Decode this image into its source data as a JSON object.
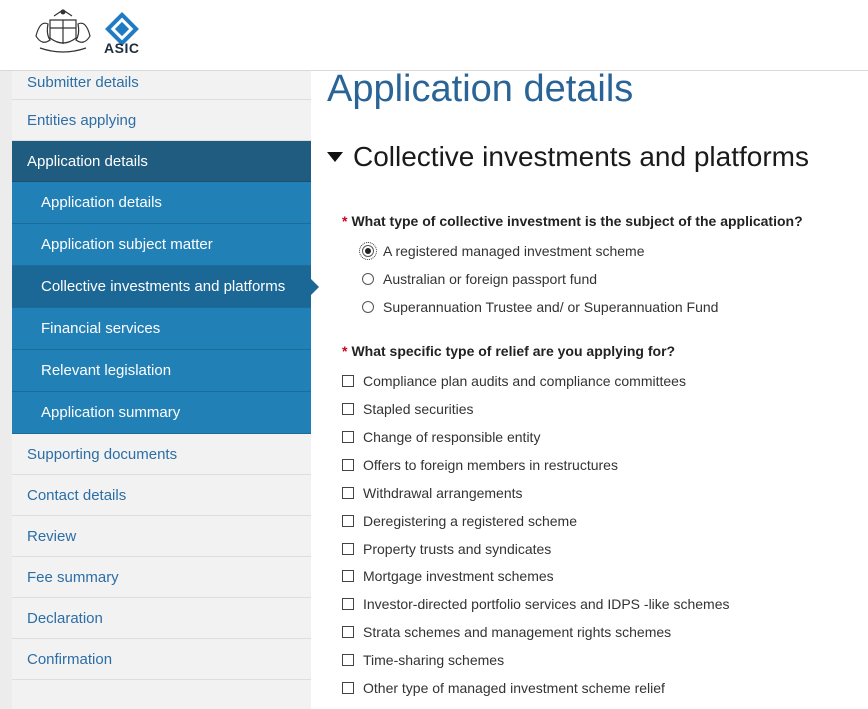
{
  "brand": {
    "logo_text": "ASIC"
  },
  "sidebar": {
    "items_top": [
      {
        "label": "Submitter details"
      },
      {
        "label": "Entities applying"
      }
    ],
    "active_section": {
      "label": "Application details"
    },
    "sub_items": [
      {
        "label": "Application details"
      },
      {
        "label": "Application subject matter"
      },
      {
        "label": "Collective investments and platforms",
        "current": true
      },
      {
        "label": "Financial services"
      },
      {
        "label": "Relevant legislation"
      },
      {
        "label": "Application summary"
      }
    ],
    "items_bottom": [
      {
        "label": "Supporting documents"
      },
      {
        "label": "Contact details"
      },
      {
        "label": "Review"
      },
      {
        "label": "Fee summary"
      },
      {
        "label": "Declaration"
      },
      {
        "label": "Confirmation"
      }
    ]
  },
  "main": {
    "page_title": "Application details",
    "section_title": "Collective investments and platforms",
    "q1": {
      "required_mark": "*",
      "label": "What type of collective investment is the subject of the application?",
      "options": [
        {
          "label": "A registered managed investment scheme",
          "selected": true
        },
        {
          "label": "Australian or foreign passport fund",
          "selected": false
        },
        {
          "label": "Superannuation Trustee and/ or Superannuation Fund",
          "selected": false
        }
      ]
    },
    "q2": {
      "required_mark": "*",
      "label": "What specific type of relief are you applying for?",
      "options": [
        {
          "label": "Compliance plan audits and compliance committees",
          "checked": false
        },
        {
          "label": "Stapled securities",
          "checked": false
        },
        {
          "label": "Change of responsible entity",
          "checked": false
        },
        {
          "label": "Offers to foreign members in restructures",
          "checked": false
        },
        {
          "label": "Withdrawal arrangements",
          "checked": false
        },
        {
          "label": "Deregistering a registered scheme",
          "checked": false
        },
        {
          "label": "Property trusts and syndicates",
          "checked": false
        },
        {
          "label": "Mortgage investment schemes",
          "checked": false
        },
        {
          "label": "Investor-directed portfolio services and IDPS -like schemes",
          "checked": false
        },
        {
          "label": "Strata schemes and management rights schemes",
          "checked": false
        },
        {
          "label": "Time-sharing schemes",
          "checked": false
        },
        {
          "label": "Other type of managed investment scheme relief",
          "checked": false
        }
      ]
    }
  }
}
